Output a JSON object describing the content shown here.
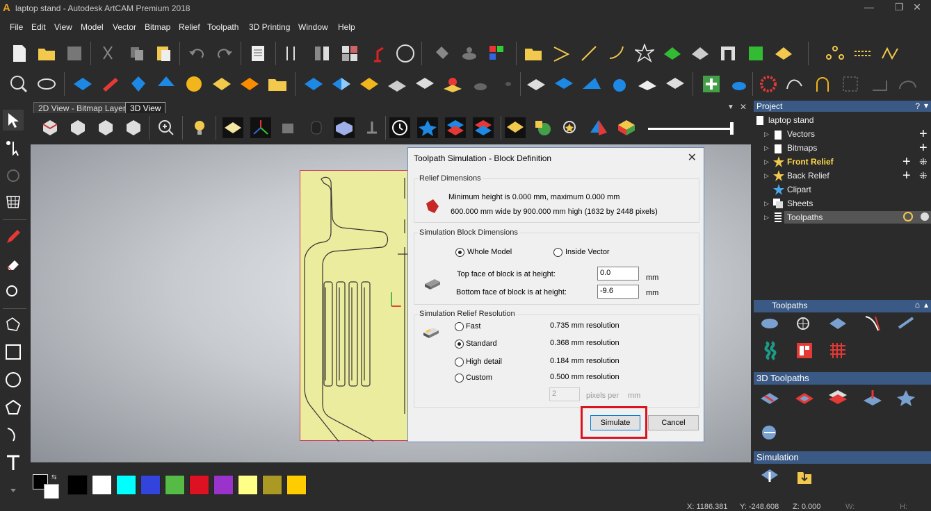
{
  "window": {
    "title": "laptop stand - Autodesk ArtCAM Premium 2018",
    "minimize": "—",
    "restore": "❐",
    "close": "✕"
  },
  "menu": [
    "File",
    "Edit",
    "View",
    "Model",
    "Vector",
    "Bitmap",
    "Relief",
    "Toolpath",
    "3D Printing",
    "Window",
    "Help"
  ],
  "tabs": [
    {
      "label": "2D View - Bitmap Layer"
    },
    {
      "label": "3D View"
    }
  ],
  "project": {
    "header": "Project",
    "help": "?",
    "items": [
      {
        "label": "laptop stand"
      },
      {
        "label": "Vectors"
      },
      {
        "label": "Bitmaps"
      },
      {
        "label": "Front Relief"
      },
      {
        "label": "Back Relief"
      },
      {
        "label": "Clipart"
      },
      {
        "label": "Sheets"
      },
      {
        "label": "Toolpaths"
      }
    ]
  },
  "toolpaths_panel": {
    "header": "Toolpaths",
    "section_3d": "3D Toolpaths",
    "section_sim": "Simulation"
  },
  "dialog": {
    "title": "Toolpath Simulation - Block Definition",
    "relief_group": "Relief Dimensions",
    "relief_line1": "Minimum height is 0.000 mm, maximum 0.000 mm",
    "relief_line2": "600.000 mm wide by 900.000 mm high (1632 by 2448 pixels)",
    "block_group": "Simulation Block Dimensions",
    "whole_model": "Whole Model",
    "inside_vector": "Inside Vector",
    "top_label": "Top face of block is at height:",
    "top_value": "0.0",
    "bottom_label": "Bottom face of block is at height:",
    "bottom_value": "-9.6",
    "unit": "mm",
    "res_group": "Simulation Relief Resolution",
    "res": [
      {
        "label": "Fast",
        "value": "0.735 mm resolution",
        "selected": false
      },
      {
        "label": "Standard",
        "value": "0.368 mm resolution",
        "selected": true
      },
      {
        "label": "High detail",
        "value": "0.184 mm resolution",
        "selected": false
      },
      {
        "label": "Custom",
        "value": "0.500 mm resolution",
        "selected": false
      }
    ],
    "pixels_value": "2",
    "pixels_label": "pixels per",
    "pixels_unit": "mm",
    "simulate": "Simulate",
    "cancel": "Cancel"
  },
  "status": {
    "x": "X: 1186.381",
    "y": "Y: -248.608",
    "z": "Z: 0.000",
    "w": "W:",
    "h": "H:"
  },
  "palette": [
    "#000000",
    "#ffffff",
    "#00ffff",
    "#3344dd",
    "#55bb44",
    "#dd1122",
    "#9933cc",
    "#ffff88",
    "#aa9922",
    "#ffcc00"
  ],
  "colors": {
    "accent": "#3a5a85",
    "highlight": "#d9141f",
    "sheet": "#ecec9e"
  }
}
